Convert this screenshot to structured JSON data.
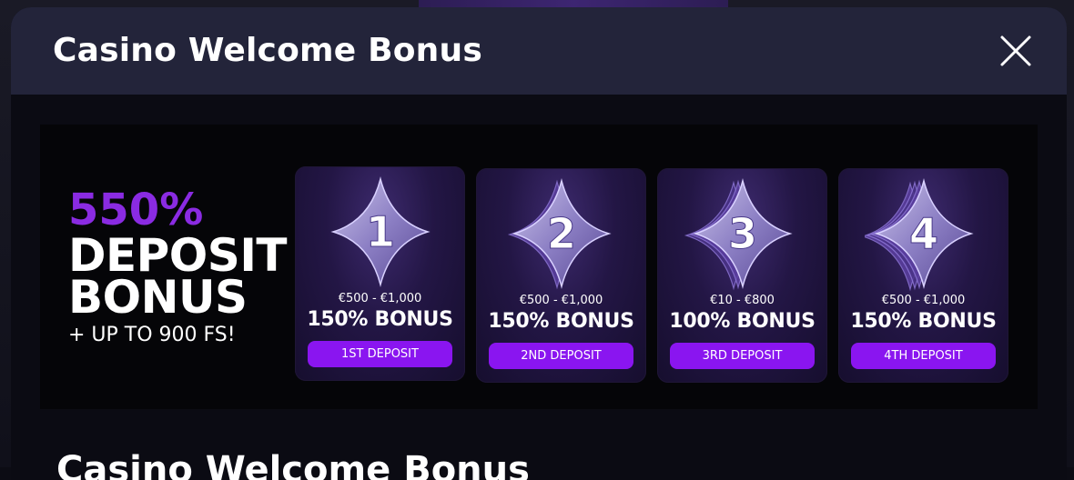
{
  "modal": {
    "title": "Casino Welcome Bonus",
    "close_icon": "close-icon"
  },
  "banner": {
    "percent": "550%",
    "line1": "DEPOSIT",
    "line2": "BONUS",
    "free_spins": "+ UP TO 900 FS!",
    "cards": [
      {
        "number": "1",
        "range": "€500 - €1,000",
        "bonus": "150% BONUS",
        "button": "1ST DEPOSIT",
        "icon": "star-1-icon"
      },
      {
        "number": "2",
        "range": "€500 - €1,000",
        "bonus": "150% BONUS",
        "button": "2ND DEPOSIT",
        "icon": "star-2-icon"
      },
      {
        "number": "3",
        "range": "€10 - €800",
        "bonus": "100% BONUS",
        "button": "3RD DEPOSIT",
        "icon": "star-3-icon"
      },
      {
        "number": "4",
        "range": "€500 - €1,000",
        "bonus": "150% BONUS",
        "button": "4TH DEPOSIT",
        "icon": "star-4-icon"
      }
    ]
  },
  "section": {
    "heading": "Casino Welcome Bonus"
  },
  "colors": {
    "accent_purple": "#8a15f0",
    "percent_purple": "#8a2be2",
    "header_bg": "#23243a"
  }
}
